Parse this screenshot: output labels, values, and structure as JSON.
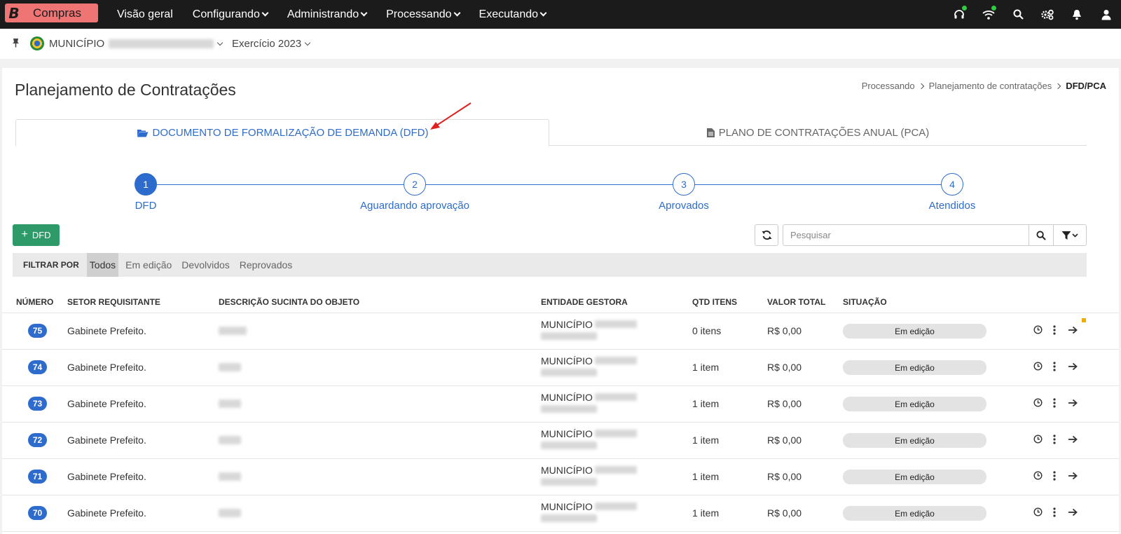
{
  "topnav": {
    "brand_letter": "B",
    "brand_name": "Compras",
    "items": [
      {
        "label": "Visão geral",
        "has_dropdown": false
      },
      {
        "label": "Configurando",
        "has_dropdown": true
      },
      {
        "label": "Administrando",
        "has_dropdown": true
      },
      {
        "label": "Processando",
        "has_dropdown": true
      },
      {
        "label": "Executando",
        "has_dropdown": true
      }
    ],
    "icons": [
      "headset-icon",
      "wifi-icon",
      "search-icon",
      "cogs-icon",
      "bell-icon",
      "user-icon"
    ]
  },
  "context": {
    "municipio_label": "MUNICÍPIO",
    "exercicio_label": "Exercício 2023"
  },
  "page": {
    "title": "Planejamento de Contratações",
    "breadcrumb": [
      "Processando",
      "Planejamento de contratações",
      "DFD/PCA"
    ]
  },
  "tabs": {
    "dfd": "DOCUMENTO DE FORMALIZAÇÃO DE DEMANDA (DFD)",
    "pca": "PLANO DE CONTRATAÇÕES ANUAL (PCA)"
  },
  "stepper": [
    {
      "num": "1",
      "label": "DFD",
      "active": true
    },
    {
      "num": "2",
      "label": "Aguardando aprovação",
      "active": false
    },
    {
      "num": "3",
      "label": "Aprovados",
      "active": false
    },
    {
      "num": "4",
      "label": "Atendidos",
      "active": false
    }
  ],
  "toolbar": {
    "add_label": "DFD",
    "search_placeholder": "Pesquisar"
  },
  "filter": {
    "title": "FILTRAR POR",
    "options": [
      "Todos",
      "Em edição",
      "Devolvidos",
      "Reprovados"
    ],
    "active": "Todos"
  },
  "table": {
    "headers": {
      "numero": "NÚMERO",
      "setor": "SETOR REQUISITANTE",
      "descricao": "DESCRIÇÃO SUCINTA DO OBJETO",
      "entidade": "ENTIDADE GESTORA",
      "qtd": "QTD ITENS",
      "valor": "VALOR TOTAL",
      "situacao": "SITUAÇÃO"
    },
    "rows": [
      {
        "numero": "75",
        "setor": "Gabinete Prefeito.",
        "entidade": "MUNICÍPIO",
        "qtd": "0 itens",
        "valor": "R$ 0,00",
        "situacao": "Em edição"
      },
      {
        "numero": "74",
        "setor": "Gabinete Prefeito.",
        "entidade": "MUNICÍPIO",
        "qtd": "1 item",
        "valor": "R$ 0,00",
        "situacao": "Em edição"
      },
      {
        "numero": "73",
        "setor": "Gabinete Prefeito.",
        "entidade": "MUNICÍPIO",
        "qtd": "1 item",
        "valor": "R$ 0,00",
        "situacao": "Em edição"
      },
      {
        "numero": "72",
        "setor": "Gabinete Prefeito.",
        "entidade": "MUNICÍPIO",
        "qtd": "1 item",
        "valor": "R$ 0,00",
        "situacao": "Em edição"
      },
      {
        "numero": "71",
        "setor": "Gabinete Prefeito.",
        "entidade": "MUNICÍPIO",
        "qtd": "1 item",
        "valor": "R$ 0,00",
        "situacao": "Em edição"
      },
      {
        "numero": "70",
        "setor": "Gabinete Prefeito.",
        "entidade": "MUNICÍPIO",
        "qtd": "1 item",
        "valor": "R$ 0,00",
        "situacao": "Em edição"
      }
    ]
  },
  "colors": {
    "nav_bg": "#1b1b1b",
    "brand": "#ef7474",
    "accent": "#2d6ccd",
    "add_button": "#2e9a69",
    "annotation_arrow": "#e02020"
  }
}
